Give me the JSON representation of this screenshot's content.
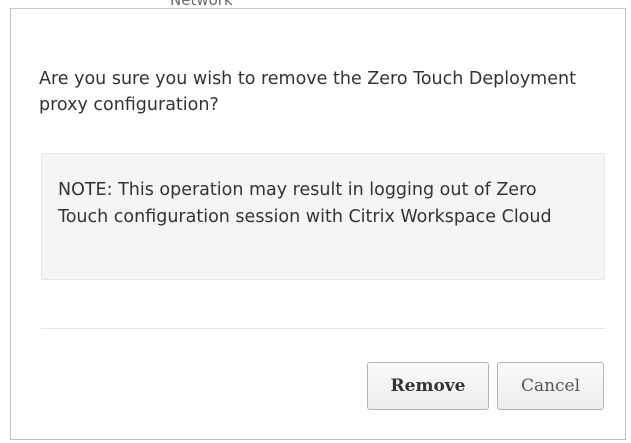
{
  "background": {
    "peek_text": "Network"
  },
  "dialog": {
    "question": "Are you sure you wish to remove the Zero Touch Deployment proxy configuration?",
    "note": "NOTE: This operation may result in logging out of Zero Touch configuration session with Citrix Workspace Cloud",
    "buttons": {
      "remove_label": "Remove",
      "cancel_label": "Cancel"
    }
  },
  "colors": {
    "text": "#333333",
    "note_background": "#f5f5f5",
    "border": "#bdbdbd"
  }
}
